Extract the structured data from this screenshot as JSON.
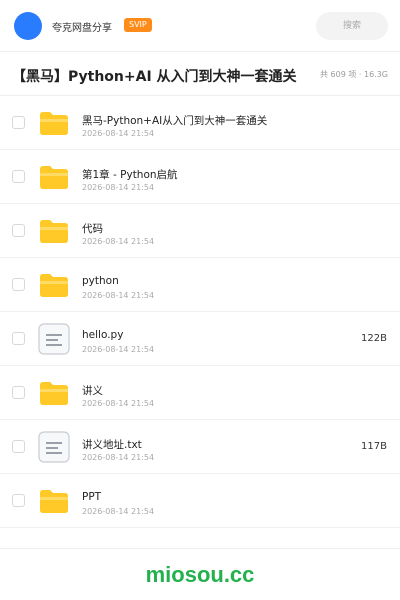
{
  "topbar": {
    "user_name": "夸克网盘分享",
    "badge": "SVIP",
    "search_placeholder": "搜索"
  },
  "share": {
    "title": "【黑马】Python+AI 从入门到大神一套通关",
    "meta": "共 609 项 · 16.3G"
  },
  "files": [
    {
      "name": "黑马-Python+AI从入门到大神一套通关",
      "date": "2026-08-14 21:54",
      "type": "folder",
      "size": ""
    },
    {
      "name": "第1章 - Python启航",
      "date": "2026-08-14 21:54",
      "type": "folder",
      "size": ""
    },
    {
      "name": "代码",
      "date": "2026-08-14 21:54",
      "type": "folder",
      "size": ""
    },
    {
      "name": "python",
      "date": "2026-08-14 21:54",
      "type": "folder",
      "size": ""
    },
    {
      "name": "hello.py",
      "date": "2026-08-14 21:54",
      "type": "file",
      "size": "122B"
    },
    {
      "name": "讲义",
      "date": "2026-08-14 21:54",
      "type": "folder",
      "size": ""
    },
    {
      "name": "讲义地址.txt",
      "date": "2026-08-14 21:54",
      "type": "file",
      "size": "117B"
    },
    {
      "name": "PPT",
      "date": "2026-08-14 21:54",
      "type": "folder",
      "size": ""
    }
  ],
  "watermark": "miosou.cc",
  "colors": {
    "avatar": "#2a7cff",
    "badge": "#ff8c1a",
    "folder": "#ffc928",
    "watermark": "#22b14c"
  },
  "icons": {
    "folder": "folder-icon",
    "file": "document-icon"
  }
}
